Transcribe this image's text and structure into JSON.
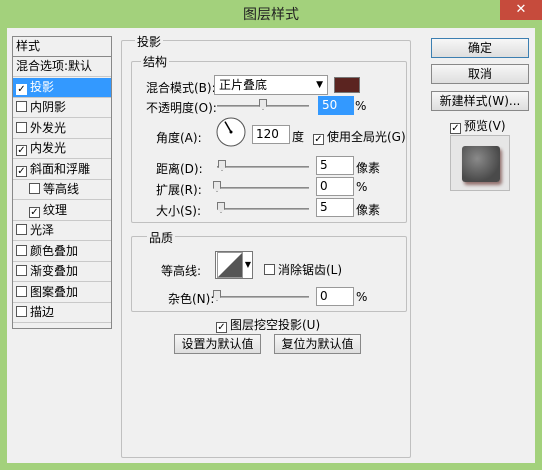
{
  "window": {
    "title": "图层样式",
    "close": "✕"
  },
  "styles": {
    "header": "样式",
    "items": [
      {
        "label": "混合选项:默认",
        "checkbox": false,
        "checked": false,
        "indent": false,
        "selected": false
      },
      {
        "label": "投影",
        "checkbox": true,
        "checked": true,
        "indent": false,
        "selected": true
      },
      {
        "label": "内阴影",
        "checkbox": true,
        "checked": false,
        "indent": false,
        "selected": false
      },
      {
        "label": "外发光",
        "checkbox": true,
        "checked": false,
        "indent": false,
        "selected": false
      },
      {
        "label": "内发光",
        "checkbox": true,
        "checked": true,
        "indent": false,
        "selected": false
      },
      {
        "label": "斜面和浮雕",
        "checkbox": true,
        "checked": true,
        "indent": false,
        "selected": false
      },
      {
        "label": "等高线",
        "checkbox": true,
        "checked": false,
        "indent": true,
        "selected": false
      },
      {
        "label": "纹理",
        "checkbox": true,
        "checked": true,
        "indent": true,
        "selected": false
      },
      {
        "label": "光泽",
        "checkbox": true,
        "checked": false,
        "indent": false,
        "selected": false
      },
      {
        "label": "颜色叠加",
        "checkbox": true,
        "checked": false,
        "indent": false,
        "selected": false
      },
      {
        "label": "渐变叠加",
        "checkbox": true,
        "checked": false,
        "indent": false,
        "selected": false
      },
      {
        "label": "图案叠加",
        "checkbox": true,
        "checked": false,
        "indent": false,
        "selected": false
      },
      {
        "label": "描边",
        "checkbox": true,
        "checked": false,
        "indent": false,
        "selected": false
      }
    ]
  },
  "drop_shadow": {
    "section_title": "投影",
    "structure": {
      "title": "结构",
      "blend_mode_label": "混合模式(B):",
      "blend_mode_value": "正片叠底",
      "color": "#5b2420",
      "opacity_label": "不透明度(O):",
      "opacity_value": "50",
      "opacity_unit": "%",
      "angle_label": "角度(A):",
      "angle_value": "120",
      "angle_unit": "度",
      "global_light_label": "使用全局光(G)",
      "global_light_checked": true,
      "distance_label": "距离(D):",
      "distance_value": "5",
      "distance_unit": "像素",
      "spread_label": "扩展(R):",
      "spread_value": "0",
      "spread_unit": "%",
      "size_label": "大小(S):",
      "size_value": "5",
      "size_unit": "像素"
    },
    "quality": {
      "title": "品质",
      "contour_label": "等高线:",
      "anti_alias_label": "消除锯齿(L)",
      "anti_alias_checked": false,
      "noise_label": "杂色(N):",
      "noise_value": "0",
      "noise_unit": "%"
    },
    "knockout_label": "图层挖空投影(U)",
    "knockout_checked": true,
    "make_default": "设置为默认值",
    "reset_default": "复位为默认值"
  },
  "buttons": {
    "ok": "确定",
    "cancel": "取消",
    "new_style": "新建样式(W)...",
    "preview_label": "预览(V)",
    "preview_checked": true
  },
  "check_mark": "✓"
}
